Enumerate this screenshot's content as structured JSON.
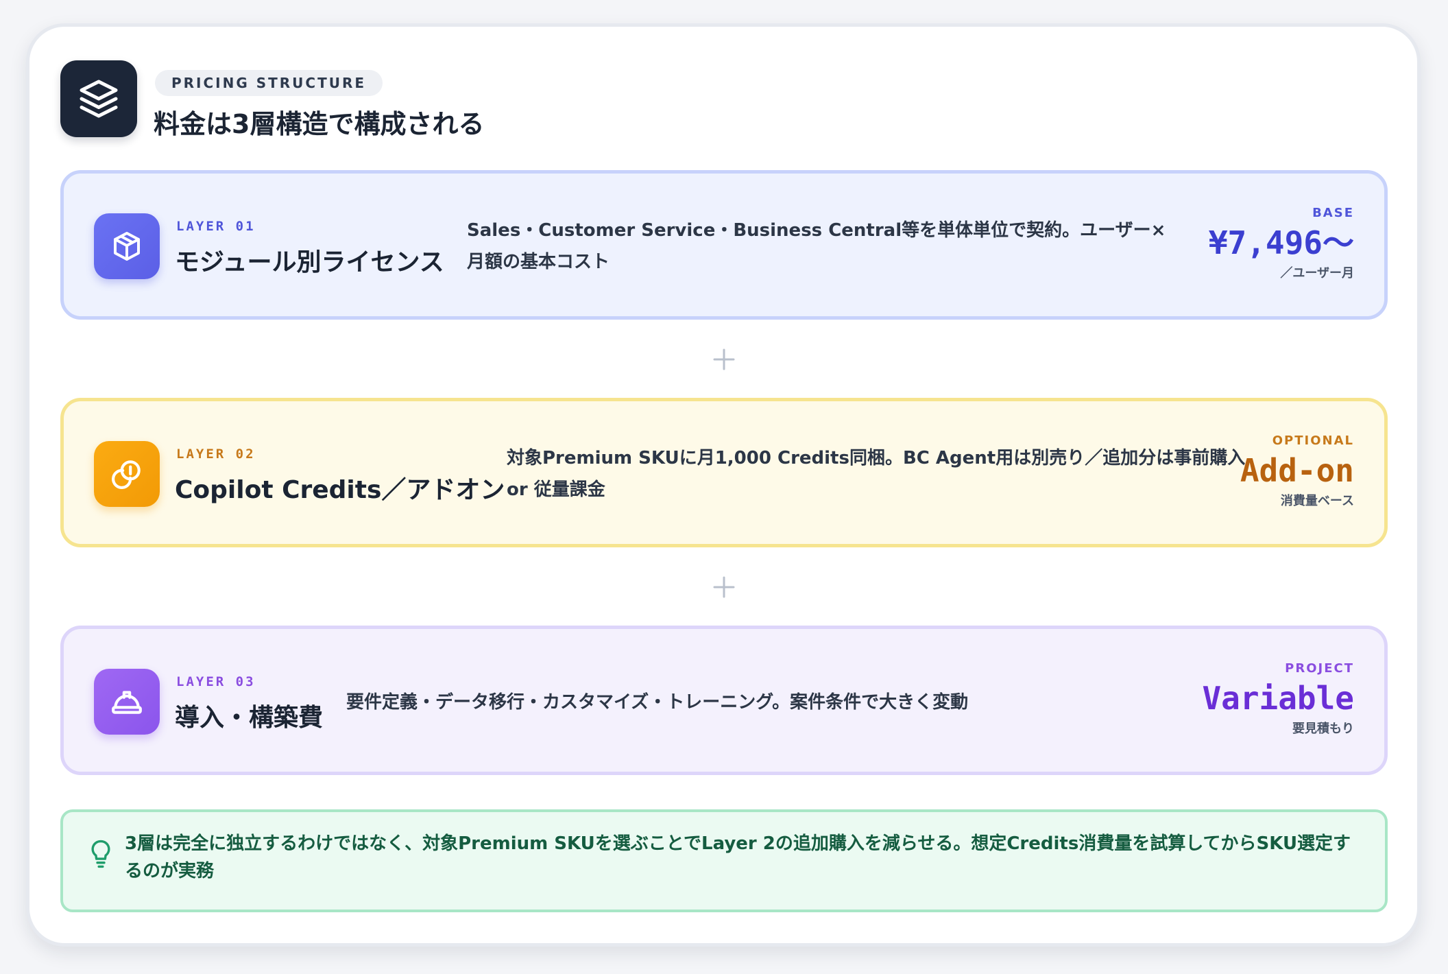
{
  "header": {
    "eyebrow": "PRICING STRUCTURE",
    "title": "料金は3層構造で構成される",
    "icon": "layers-icon"
  },
  "layers": [
    {
      "tag": "LAYER 01",
      "name": "モジュール別ライセンス",
      "description": "Sales・Customer Service・Business Central等を単体単位で契約。ユーザー×月額の基本コスト",
      "kicker": "BASE",
      "price": "¥7,496〜",
      "price_sub": "／ユーザー月",
      "icon": "box-icon",
      "accent": "#5b5fe6"
    },
    {
      "tag": "LAYER 02",
      "name": "Copilot Credits／アドオン",
      "description": "対象Premium SKUに月1,000 Credits同梱。BC Agent用は別売り／追加分は事前購入 or 従量課金",
      "kicker": "OPTIONAL",
      "price": "Add-on",
      "price_sub": "消費量ベース",
      "icon": "coins-icon",
      "accent": "#f29a06"
    },
    {
      "tag": "LAYER 03",
      "name": "導入・構築費",
      "description": "要件定義・データ移行・カスタマイズ・トレーニング。案件条件で大きく変動",
      "kicker": "PROJECT",
      "price": "Variable",
      "price_sub": "要見積もり",
      "icon": "hard-hat-icon",
      "accent": "#8b55ec"
    }
  ],
  "separator_icon": "plus-icon",
  "note": {
    "icon": "lightbulb-icon",
    "text": "3層は完全に独立するわけではなく、対象Premium SKUを選ぶことでLayer 2の追加購入を減らせる。想定Credits消費量を試算してからSKU選定するのが実務"
  }
}
